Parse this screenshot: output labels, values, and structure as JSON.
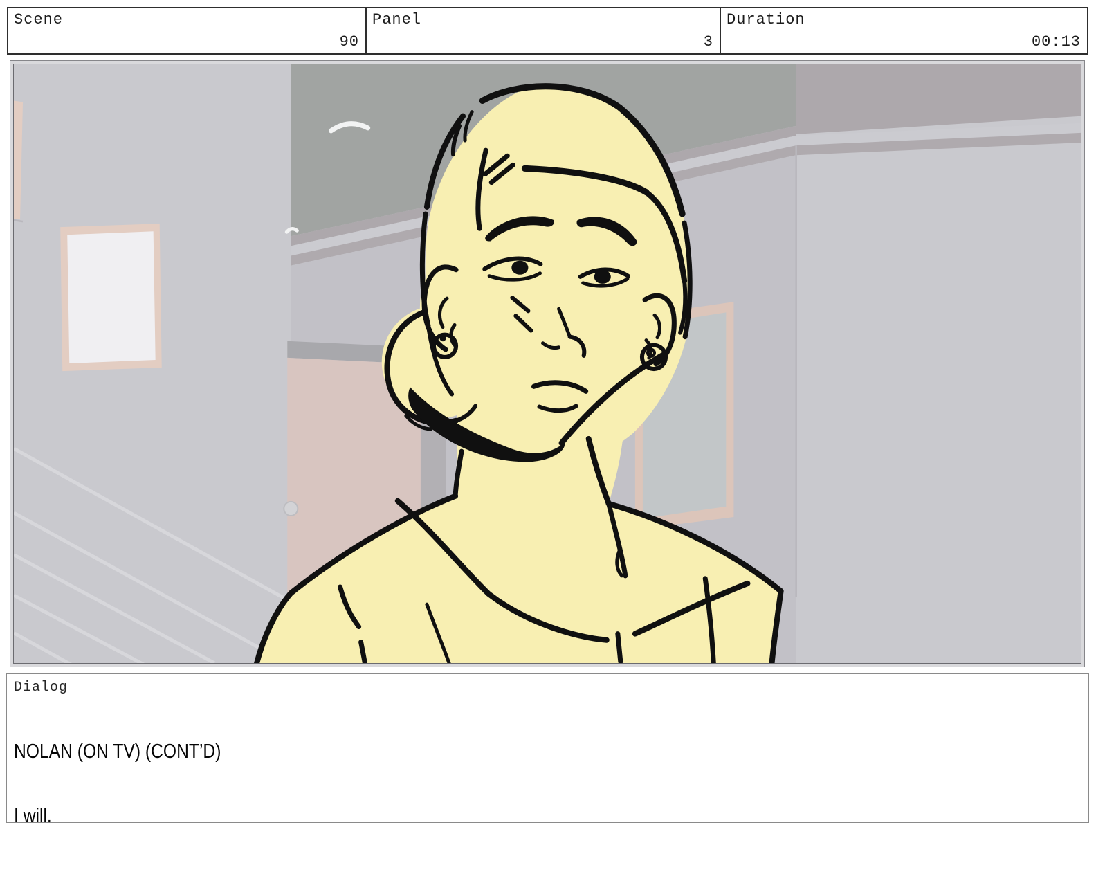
{
  "header": {
    "cells": [
      {
        "label": "Scene",
        "value": "90"
      },
      {
        "label": "Panel",
        "value": "3"
      },
      {
        "label": "Duration",
        "value": "00:13"
      }
    ]
  },
  "dialog": {
    "label": "Dialog",
    "lines": [
      "NOLAN (ON TV) (CONT’D)",
      "I will."
    ]
  },
  "scene": {
    "description": "Hand-inked storyboard frame: a worried blonde woman with a low hair bun and round stud earrings, shown from the chest up in a sleeveless V-neck top, standing in a gray hallway interior with a door, picture frames, crown molding and stair banister lines",
    "character": "woman-with-bun",
    "colors": {
      "page_bg": "#FFFFFF",
      "header_line": "#2E2E2E",
      "text_dark": "#1B1B1B",
      "panel_edge": "#86868A",
      "panel_frame": "#D9D9DC",
      "panel_inner_line": "#6B6B70",
      "dialog_line": "#8A8A8A",
      "wall": "#C9C9CE",
      "wall_shade": "#C2C1C7",
      "ceiling": "#A1A4A2",
      "band": "#ADA8AC",
      "molding_light": "#CBCBD0",
      "molding_dark": "#AFAAAE",
      "corner_line": "#B9B7BD",
      "door": "#D8C5C0",
      "door_header": "#A8A8AC",
      "door_jamb": "#B2B0B4",
      "knob": "#D3D3D6",
      "knob_line": "#BDBDC1",
      "frame_tan": "#E3CDC2",
      "frame_white": "#F0EFF2",
      "frame_tan2": "#DCC5BA",
      "frame_gray": "#C2C6C8",
      "stair_rail": "#D7D7DB",
      "skin": "#F8EFB2",
      "ink": "#101010",
      "light_arc": "#F2F3F3"
    }
  }
}
